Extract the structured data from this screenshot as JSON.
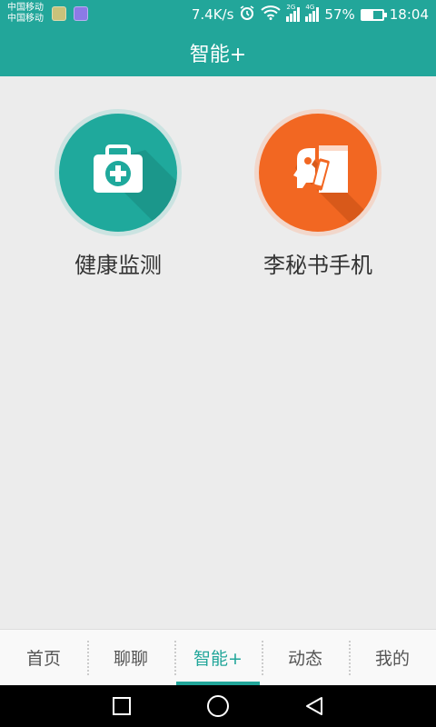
{
  "status_bar": {
    "carrier1": "中国移动",
    "carrier2": "中国移动",
    "net_speed": "7.4K/s",
    "sig1_tag": "2G",
    "sig2_tag": "4G",
    "battery_percent": "57%",
    "battery_level": 0.57,
    "time": "18:04"
  },
  "header": {
    "title": "智能+"
  },
  "tiles": [
    {
      "label": "健康监测",
      "icon": "medical-kit-icon",
      "color": "#1fa99c"
    },
    {
      "label": "李秘书手机",
      "icon": "phone-secretary-icon",
      "color": "#f26722"
    }
  ],
  "tabs": [
    {
      "label": "首页"
    },
    {
      "label": "聊聊"
    },
    {
      "label": "智能+"
    },
    {
      "label": "动态"
    },
    {
      "label": "我的"
    }
  ],
  "active_tab": 2,
  "colors": {
    "primary": "#22a69a",
    "accent_orange": "#f26722",
    "background": "#ececec"
  }
}
